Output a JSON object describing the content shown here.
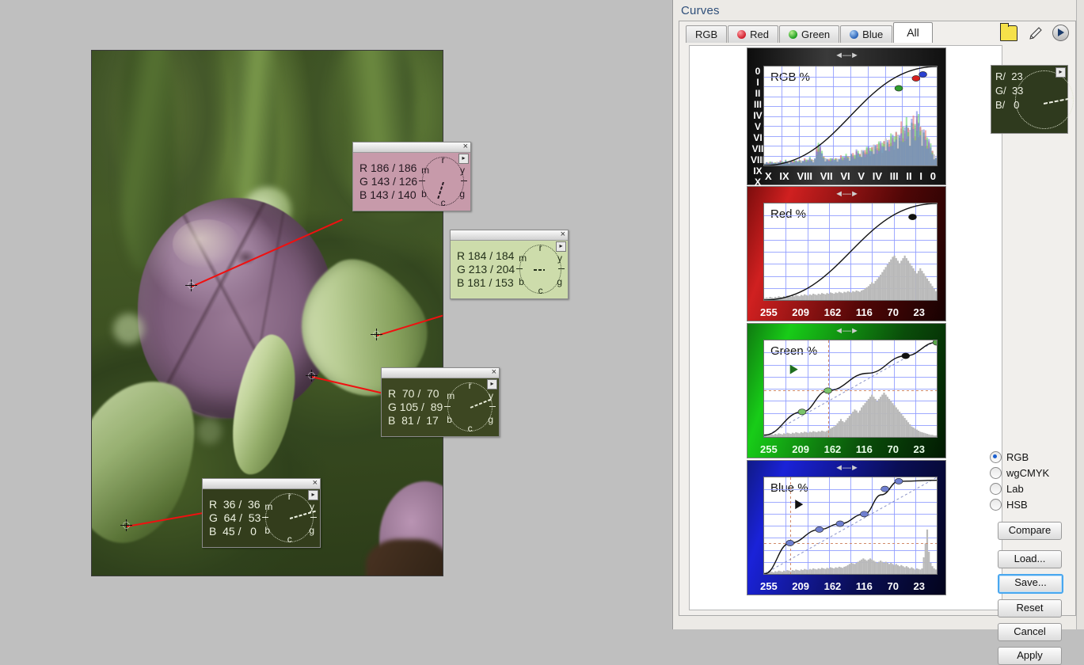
{
  "window": {
    "title": "Curves"
  },
  "tabs": [
    {
      "id": "rgb",
      "label": "RGB",
      "icon": "",
      "active": false
    },
    {
      "id": "red",
      "label": "Red",
      "icon": "red-dot-icon",
      "active": false
    },
    {
      "id": "green",
      "label": "Green",
      "icon": "green-dot-icon",
      "active": false
    },
    {
      "id": "blue",
      "label": "Blue",
      "icon": "blue-dot-icon",
      "active": false
    },
    {
      "id": "all",
      "label": "All",
      "icon": "",
      "active": true
    }
  ],
  "toolbar": {
    "folder_icon": "folder-icon",
    "pen_icon": "eyedropper-icon",
    "play_icon": "play-icon"
  },
  "readout": {
    "r_label": "R/",
    "r_value": "23",
    "g_label": "G/",
    "g_value": "33",
    "b_label": "B/",
    "b_value": "0",
    "text": "R/  23\nG/  33\nB/   0"
  },
  "side_panel": {
    "color_modes": [
      {
        "label": "RGB",
        "selected": true
      },
      {
        "label": "wgCMYK",
        "selected": false
      },
      {
        "label": "Lab",
        "selected": false
      },
      {
        "label": "HSB",
        "selected": false
      }
    ],
    "buttons": [
      {
        "label": "Compare",
        "focused": false
      },
      {
        "label": "Load...",
        "focused": false
      },
      {
        "label": "Save...",
        "focused": true
      },
      {
        "label": "Reset",
        "focused": false
      },
      {
        "label": "Cancel",
        "focused": false
      },
      {
        "label": "Apply",
        "focused": false
      }
    ]
  },
  "samples": [
    {
      "id": "sample-1",
      "bg": "#c79aaa",
      "text": "R 186 / 186\nG 143 / 126\nB 143 / 140",
      "r": "186 / 186",
      "g": "143 / 126",
      "b": "143 / 140",
      "wheel_labels": [
        "r",
        "y",
        "g",
        "c",
        "b",
        "m"
      ],
      "needle_angle": 108,
      "close_label": "×"
    },
    {
      "id": "sample-2",
      "bg": "#cddcab",
      "text": "R 184 / 184\nG 213 / 204\nB 181 / 153",
      "r": "184 / 184",
      "g": "213 / 204",
      "b": "181 / 153",
      "wheel_labels": [
        "r",
        "y",
        "g",
        "c",
        "b",
        "m"
      ],
      "needle_angle": 0,
      "close_label": "×"
    },
    {
      "id": "sample-3",
      "bg": "#3d4722",
      "text": "R  70 /  70\nG 105 /  89\nB  81 /  17",
      "r": "70 / 70",
      "g": "105 / 89",
      "b": "81 / 17",
      "wheel_labels": [
        "r",
        "y",
        "g",
        "c",
        "b",
        "m"
      ],
      "needle_angle": -22,
      "close_label": "×"
    },
    {
      "id": "sample-4",
      "bg": "#333d1c",
      "text": "R  36 /  36\nG  64 /  53\nB  45 /   0",
      "r": "36 / 36",
      "g": "64 / 53",
      "b": "45 / 0",
      "wheel_labels": [
        "r",
        "y",
        "g",
        "c",
        "b",
        "m"
      ],
      "needle_angle": -16,
      "close_label": "×"
    }
  ],
  "chart_data": [
    {
      "id": "rgb-panel",
      "type": "line",
      "title": "RGB %",
      "xlabel": "",
      "ylabel": "",
      "xticks": [
        "X",
        "IX",
        "VIII",
        "VII",
        "VI",
        "V",
        "IV",
        "III",
        "II",
        "I",
        "0"
      ],
      "yticks": [
        "0",
        "I",
        "II",
        "III",
        "IV",
        "V",
        "VI",
        "VII",
        "VIII",
        "IX",
        "X"
      ],
      "xlim": [
        0,
        100
      ],
      "ylim": [
        0,
        100
      ],
      "grid": true,
      "curve_points": [
        [
          0,
          0
        ],
        [
          100,
          100
        ]
      ],
      "control_points": [
        {
          "x": 78,
          "y": 78,
          "color": "#2f9e2f",
          "label": "green-node"
        },
        {
          "x": 88,
          "y": 88,
          "color": "#d62020",
          "label": "red-node"
        },
        {
          "x": 92,
          "y": 92,
          "color": "#2a3fd0",
          "label": "blue-node"
        }
      ],
      "histogram_note": "composite RGB histogram, peaks in shadows/mid-right",
      "histogram": [
        4,
        5,
        4,
        6,
        5,
        4,
        5,
        6,
        5,
        7,
        6,
        5,
        8,
        6,
        5,
        7,
        6,
        8,
        7,
        6,
        9,
        8,
        7,
        10,
        9,
        8,
        12,
        10,
        9,
        11,
        26,
        34,
        28,
        20,
        15,
        12,
        10,
        9,
        11,
        10,
        9,
        12,
        11,
        10,
        14,
        13,
        12,
        16,
        15,
        14,
        18,
        17,
        16,
        22,
        20,
        19,
        25,
        23,
        21,
        28,
        26,
        24,
        30,
        34,
        31,
        29,
        36,
        33,
        31,
        40,
        44,
        38,
        35,
        48,
        42,
        39,
        55,
        50,
        46,
        60,
        58,
        52,
        66,
        62,
        58,
        70,
        68,
        62,
        74,
        70,
        64,
        58,
        54,
        48,
        42,
        36,
        30,
        24,
        18,
        12
      ]
    },
    {
      "id": "red-panel",
      "type": "line",
      "title": "Red %",
      "xticks": [
        "255",
        "209",
        "162",
        "116",
        "70",
        "23"
      ],
      "xlim": [
        0,
        100
      ],
      "ylim": [
        0,
        100
      ],
      "grid": true,
      "curve_points": [
        [
          0,
          0
        ],
        [
          100,
          100
        ]
      ],
      "control_points": [
        {
          "x": 86,
          "y": 86,
          "color": "#111111",
          "label": "node"
        }
      ],
      "histogram": [
        3,
        4,
        3,
        5,
        4,
        3,
        5,
        4,
        6,
        5,
        4,
        6,
        5,
        7,
        6,
        5,
        7,
        6,
        8,
        7,
        6,
        8,
        7,
        9,
        8,
        7,
        9,
        8,
        10,
        9,
        8,
        10,
        9,
        11,
        10,
        9,
        11,
        10,
        12,
        11,
        10,
        12,
        11,
        13,
        12,
        11,
        13,
        12,
        14,
        13,
        12,
        14,
        13,
        15,
        14,
        13,
        15,
        16,
        18,
        20,
        22,
        25,
        28,
        26,
        30,
        33,
        36,
        40,
        44,
        48,
        52,
        56,
        60,
        64,
        68,
        70,
        66,
        62,
        58,
        62,
        66,
        70,
        66,
        62,
        58,
        54,
        50,
        46,
        42,
        46,
        50,
        46,
        42,
        38,
        34,
        30,
        26,
        22,
        18,
        14
      ]
    },
    {
      "id": "green-panel",
      "type": "line",
      "title": "Green %",
      "xticks": [
        "255",
        "209",
        "162",
        "116",
        "70",
        "23"
      ],
      "xlim": [
        0,
        100
      ],
      "ylim": [
        0,
        100
      ],
      "grid": true,
      "reference_line": true,
      "guides": {
        "vertical_x": 37,
        "horizontal_y": 48
      },
      "curve_points": [
        [
          0,
          2
        ],
        [
          22,
          26
        ],
        [
          37,
          48
        ],
        [
          60,
          66
        ],
        [
          82,
          84
        ],
        [
          100,
          98
        ]
      ],
      "control_points": [
        {
          "x": 22,
          "y": 26,
          "color": "#7ac46a",
          "label": "node"
        },
        {
          "x": 37,
          "y": 48,
          "color": "#7ac46a",
          "label": "node"
        },
        {
          "x": 82,
          "y": 84,
          "color": "#111111",
          "label": "node"
        },
        {
          "x": 100,
          "y": 98,
          "color": "#5aa84a",
          "label": "node"
        }
      ],
      "marker_arrow": {
        "x": 15,
        "y": 70,
        "color": "#1f6f1f"
      },
      "histogram": [
        4,
        5,
        4,
        6,
        5,
        4,
        6,
        5,
        7,
        6,
        5,
        7,
        6,
        8,
        7,
        6,
        8,
        7,
        9,
        8,
        7,
        9,
        8,
        10,
        9,
        8,
        10,
        9,
        11,
        10,
        9,
        11,
        10,
        12,
        11,
        10,
        12,
        14,
        16,
        18,
        20,
        22,
        26,
        30,
        34,
        30,
        28,
        32,
        36,
        40,
        44,
        48,
        52,
        50,
        46,
        50,
        56,
        60,
        64,
        68,
        72,
        76,
        80,
        76,
        72,
        68,
        72,
        76,
        80,
        84,
        80,
        76,
        72,
        68,
        64,
        60,
        56,
        52,
        48,
        44,
        40,
        36,
        32,
        28,
        24,
        20,
        18,
        16,
        14,
        12,
        10,
        9,
        8,
        7,
        6,
        5,
        4,
        4,
        3,
        3
      ]
    },
    {
      "id": "blue-panel",
      "type": "line",
      "title": "Blue %",
      "xticks": [
        "255",
        "209",
        "162",
        "116",
        "70",
        "23"
      ],
      "xlim": [
        0,
        100
      ],
      "ylim": [
        0,
        100
      ],
      "grid": true,
      "reference_line": true,
      "guides": {
        "vertical_x": 15,
        "horizontal_y": 32
      },
      "curve_points": [
        [
          0,
          0
        ],
        [
          15,
          32
        ],
        [
          32,
          46
        ],
        [
          44,
          52
        ],
        [
          58,
          62
        ],
        [
          68,
          82
        ],
        [
          78,
          96
        ],
        [
          100,
          97
        ]
      ],
      "control_points": [
        {
          "x": 15,
          "y": 32,
          "color": "#6f7fd0",
          "label": "node"
        },
        {
          "x": 32,
          "y": 46,
          "color": "#6f7fd0",
          "label": "node"
        },
        {
          "x": 44,
          "y": 52,
          "color": "#6f7fd0",
          "label": "node"
        },
        {
          "x": 58,
          "y": 62,
          "color": "#6f7fd0",
          "label": "node"
        },
        {
          "x": 70,
          "y": 88,
          "color": "#6f7fd0",
          "label": "node"
        },
        {
          "x": 78,
          "y": 96,
          "color": "#6f7fd0",
          "label": "node"
        }
      ],
      "marker_arrow": {
        "x": 18,
        "y": 72,
        "color": "#111111"
      },
      "histogram": [
        3,
        4,
        3,
        5,
        4,
        3,
        5,
        4,
        6,
        5,
        4,
        6,
        5,
        7,
        6,
        5,
        7,
        6,
        8,
        7,
        6,
        8,
        7,
        9,
        8,
        7,
        9,
        8,
        10,
        9,
        8,
        10,
        9,
        11,
        10,
        9,
        11,
        10,
        12,
        11,
        10,
        12,
        11,
        13,
        12,
        11,
        13,
        14,
        16,
        18,
        20,
        19,
        18,
        20,
        22,
        24,
        26,
        28,
        26,
        24,
        26,
        28,
        26,
        24,
        22,
        20,
        22,
        24,
        22,
        20,
        22,
        20,
        18,
        20,
        18,
        16,
        18,
        16,
        14,
        16,
        14,
        12,
        14,
        12,
        10,
        12,
        10,
        8,
        10,
        9,
        8,
        10,
        30,
        55,
        80,
        40,
        20,
        14,
        10,
        8
      ]
    }
  ],
  "photo": {
    "subject": "artichoke-photo",
    "alt": "close-up of a purple artichoke bud among green leaves"
  }
}
